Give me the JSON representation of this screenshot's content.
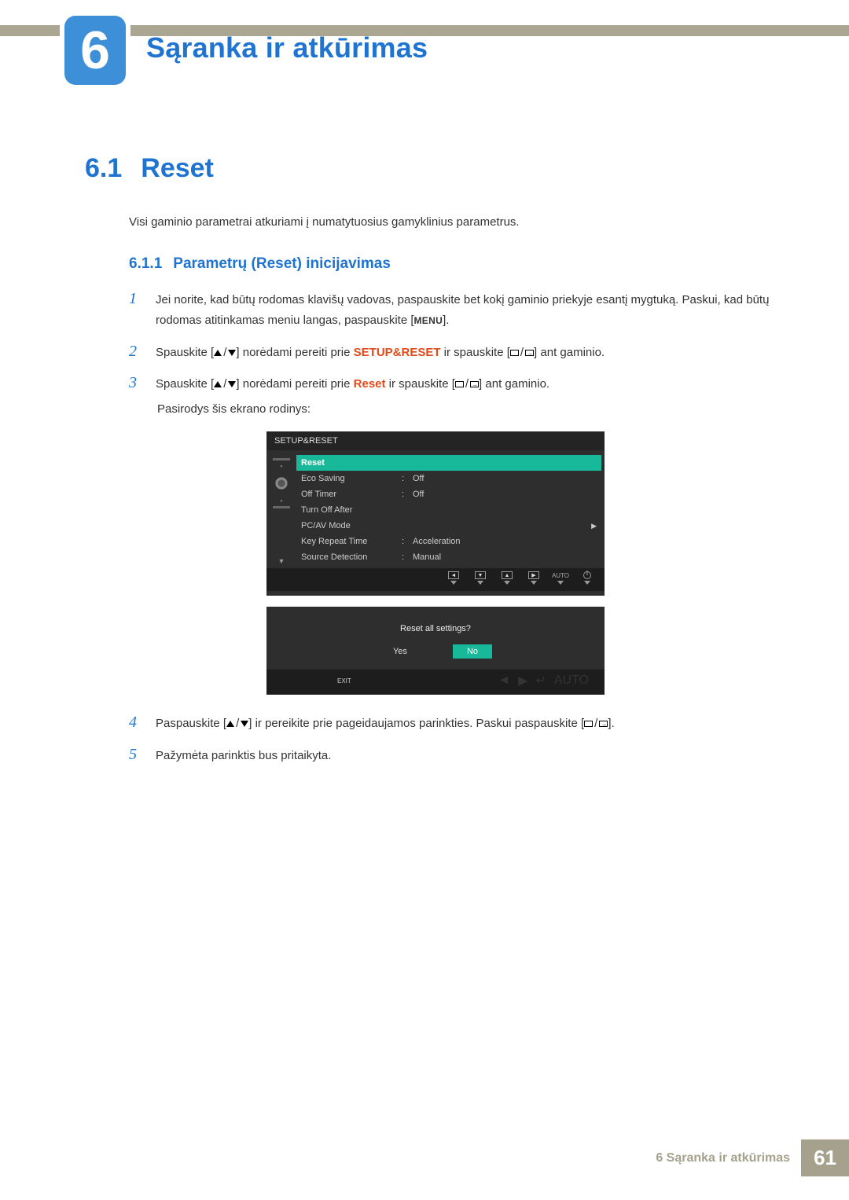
{
  "chapter": {
    "number": "6",
    "title": "Sąranka ir atkūrimas"
  },
  "section": {
    "number": "6.1",
    "title": "Reset"
  },
  "intro": "Visi gaminio parametrai atkuriami į numatytuosius gamyklinius parametrus.",
  "subsection": {
    "number": "6.1.1",
    "title": "Parametrų (Reset) inicijavimas"
  },
  "steps": {
    "s1num": "1",
    "s1_a": "Jei norite, kad būtų rodomas klavišų vadovas, paspauskite bet kokį gaminio priekyje esantį mygtuką. Paskui, kad būtų rodomas atitinkamas meniu langas, paspauskite [",
    "s1_menu": "MENU",
    "s1_b": "].",
    "s2num": "2",
    "s2_a": "Spauskite [",
    "s2_b": "] norėdami pereiti prie ",
    "s2_target": "SETUP&RESET",
    "s2_c": " ir spauskite [",
    "s2_d": "] ant gaminio.",
    "s3num": "3",
    "s3_a": "Spauskite [",
    "s3_b": "] norėdami pereiti prie ",
    "s3_target": "Reset",
    "s3_c": " ir spauskite [",
    "s3_d": "] ant gaminio.",
    "s3_after": "Pasirodys šis ekrano rodinys:",
    "s4num": "4",
    "s4_a": "Paspauskite [",
    "s4_b": "] ir pereikite prie pageidaujamos parinkties. Paskui paspauskite [",
    "s4_c": "].",
    "s5num": "5",
    "s5": "Pažymėta parinktis bus pritaikyta."
  },
  "osd": {
    "title": "SETUP&RESET",
    "rows": [
      {
        "label": "Reset",
        "val": "",
        "selected": true
      },
      {
        "label": "Eco Saving",
        "val": "Off"
      },
      {
        "label": "Off Timer",
        "val": "Off"
      },
      {
        "label": "Turn Off After",
        "val": ""
      },
      {
        "label": "PC/AV Mode",
        "val": "",
        "arrow": true
      },
      {
        "label": "Key Repeat Time",
        "val": "Acceleration"
      },
      {
        "label": "Source Detection",
        "val": "Manual"
      }
    ],
    "nav": {
      "auto": "AUTO"
    },
    "confirm": {
      "msg": "Reset all settings?",
      "yes": "Yes",
      "no": "No",
      "exit": "EXIT",
      "auto": "AUTO"
    }
  },
  "footer": {
    "text": "6 Sąranka ir atkūrimas",
    "page": "61"
  }
}
